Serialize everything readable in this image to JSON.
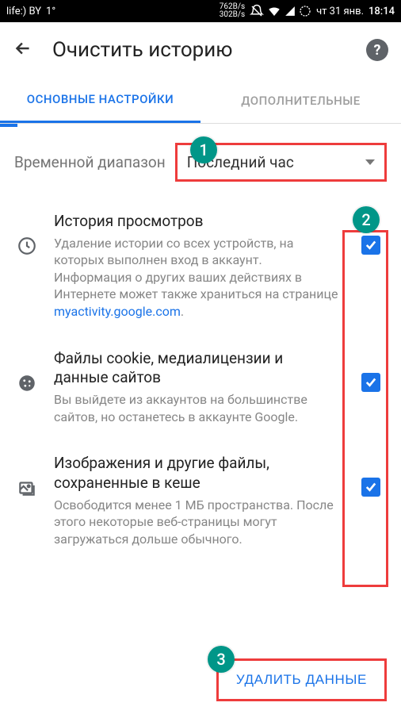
{
  "status_bar": {
    "carrier": "life:) BY",
    "temperature": "1°",
    "speed_down": "762B/s",
    "speed_up": "302B/s",
    "date": "чт 31 янв.",
    "time": "18:14"
  },
  "app_bar": {
    "title": "Очистить историю"
  },
  "tabs": {
    "active": "ОСНОВНЫЕ НАСТРОЙКИ",
    "inactive": "ДОПОЛНИТЕЛЬНЫЕ"
  },
  "time_range": {
    "label": "Временной диапазон",
    "value": "Последний час"
  },
  "items": [
    {
      "title": "История просмотров",
      "desc_pre": "Удаление истории со всех устройств, на которых выполнен вход в аккаунт. Информация о других ваших действиях в Интернете может также храниться на странице ",
      "link": "myactivity.google.com",
      "desc_post": ".",
      "checked": true
    },
    {
      "title": "Файлы cookie, медиалицензии и данные сайтов",
      "desc_pre": "Вы выйдете из аккаунтов на большинстве сайтов, но останетесь в аккаунте Google.",
      "link": "",
      "desc_post": "",
      "checked": true
    },
    {
      "title": "Изображения и другие файлы, сохраненные в кеше",
      "desc_pre": "Освободится менее 1 МБ пространства. После этого некоторые веб-страницы могут загружаться дольше обычного.",
      "link": "",
      "desc_post": "",
      "checked": true
    }
  ],
  "delete_button": "УДАЛИТЬ ДАННЫЕ",
  "badges": {
    "one": "1",
    "two": "2",
    "three": "3"
  }
}
